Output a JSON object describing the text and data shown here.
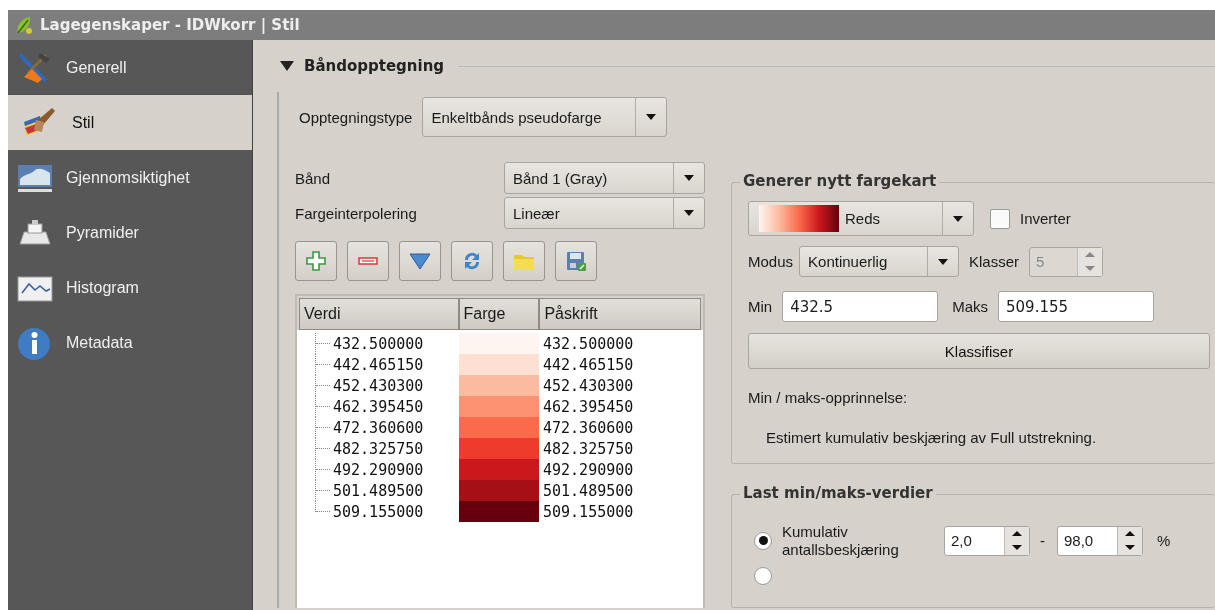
{
  "window": {
    "title": "Lagegenskaper - IDWkorr | Stil"
  },
  "sidebar": {
    "items": [
      {
        "label": "Generell",
        "selected": false
      },
      {
        "label": "Stil",
        "selected": true
      },
      {
        "label": "Gjennomsiktighet",
        "selected": false
      },
      {
        "label": "Pyramider",
        "selected": false
      },
      {
        "label": "Histogram",
        "selected": false
      },
      {
        "label": "Metadata",
        "selected": false
      }
    ]
  },
  "section": {
    "title": "Båndopptegning",
    "expanded": true
  },
  "render_type": {
    "label": "Opptegningstype",
    "value": "Enkeltbånds pseudofarge"
  },
  "band": {
    "label": "Bånd",
    "value": "Bånd 1 (Gray)"
  },
  "interpolation": {
    "label": "Fargeinterpolering",
    "value": "Lineær"
  },
  "table": {
    "columns": [
      "Verdi",
      "Farge",
      "Påskrift"
    ],
    "rows": [
      {
        "value": "432.500000",
        "color": "#fff5f0",
        "label": "432.500000"
      },
      {
        "value": "442.465150",
        "color": "#fee0d2",
        "label": "442.465150"
      },
      {
        "value": "452.430300",
        "color": "#fcbba1",
        "label": "452.430300"
      },
      {
        "value": "462.395450",
        "color": "#fc9272",
        "label": "462.395450"
      },
      {
        "value": "472.360600",
        "color": "#fb6a4a",
        "label": "472.360600"
      },
      {
        "value": "482.325750",
        "color": "#ef3b2c",
        "label": "482.325750"
      },
      {
        "value": "492.290900",
        "color": "#cb181d",
        "label": "492.290900"
      },
      {
        "value": "501.489500",
        "color": "#a50f15",
        "label": "501.489500"
      },
      {
        "value": "509.155000",
        "color": "#67000d",
        "label": "509.155000"
      }
    ]
  },
  "generate": {
    "title": "Generer nytt fargekart",
    "ramp": {
      "value": "Reds"
    },
    "invert": {
      "label": "Inverter",
      "checked": false
    },
    "mode": {
      "label": "Modus",
      "value": "Kontinuerlig"
    },
    "classes": {
      "label": "Klasser",
      "value": "5",
      "disabled": true
    },
    "min": {
      "label": "Min",
      "value": "432.5"
    },
    "max": {
      "label": "Maks",
      "value": "509.155"
    },
    "classify_button": "Klassifiser",
    "origin_label": "Min / maks-opprinnelse:",
    "origin_text": "Estimert kumulativ beskjæring av Full utstrekning."
  },
  "load": {
    "title": "Last min/maks-verdier",
    "options": [
      {
        "kind": "range",
        "label": "Kumulativ antallsbeskjæring",
        "selected": true,
        "from": "2,0",
        "separator": "-",
        "to": "98,0",
        "unit": "%"
      },
      {
        "kind": "cut",
        "selected": false
      }
    ]
  }
}
